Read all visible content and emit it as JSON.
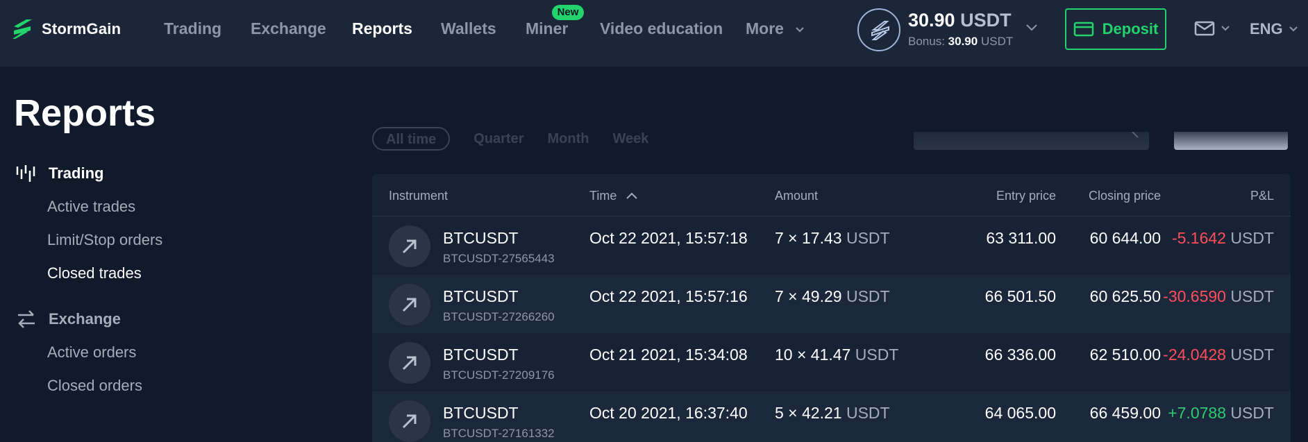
{
  "brand": {
    "name": "StormGain"
  },
  "nav": [
    {
      "label": "Trading"
    },
    {
      "label": "Exchange"
    },
    {
      "label": "Reports"
    },
    {
      "label": "Wallets"
    },
    {
      "label": "Miner",
      "badge": "New"
    },
    {
      "label": "Video education"
    },
    {
      "label": "More"
    }
  ],
  "balance": {
    "amount": "30.90",
    "currency": "USDT",
    "bonus_label": "Bonus:",
    "bonus_value": "30.90",
    "bonus_currency": "USDT"
  },
  "deposit": {
    "label": "Deposit"
  },
  "language": {
    "label": "ENG"
  },
  "page": {
    "title": "Reports"
  },
  "sidebar": {
    "sections": [
      {
        "label": "Trading",
        "items": [
          "Active trades",
          "Limit/Stop orders",
          "Closed trades"
        ]
      },
      {
        "label": "Exchange",
        "items": [
          "Active orders",
          "Closed orders"
        ]
      }
    ]
  },
  "filters": {
    "periods": [
      "All time",
      "Quarter",
      "Month",
      "Week"
    ]
  },
  "table": {
    "columns": [
      "Instrument",
      "Time",
      "Amount",
      "Entry price",
      "Closing price",
      "P&L"
    ],
    "rows": [
      {
        "instrument": "BTCUSDT",
        "id": "BTCUSDT-27565443",
        "time": "Oct 22 2021, 15:57:18",
        "amount": "7 × 17.43",
        "amount_unit": "USDT",
        "entry": "63 311.00",
        "closing": "60 644.00",
        "pnl": "-5.1642",
        "pnl_unit": "USDT"
      },
      {
        "instrument": "BTCUSDT",
        "id": "BTCUSDT-27266260",
        "time": "Oct 22 2021, 15:57:16",
        "amount": "7 × 49.29",
        "amount_unit": "USDT",
        "entry": "66 501.50",
        "closing": "60 625.50",
        "pnl": "-30.6590",
        "pnl_unit": "USDT"
      },
      {
        "instrument": "BTCUSDT",
        "id": "BTCUSDT-27209176",
        "time": "Oct 21 2021, 15:34:08",
        "amount": "10 × 41.47",
        "amount_unit": "USDT",
        "entry": "66 336.00",
        "closing": "62 510.00",
        "pnl": "-24.0428",
        "pnl_unit": "USDT"
      },
      {
        "instrument": "BTCUSDT",
        "id": "BTCUSDT-27161332",
        "time": "Oct 20 2021, 16:37:40",
        "amount": "5 × 42.21",
        "amount_unit": "USDT",
        "entry": "64 065.00",
        "closing": "66 459.00",
        "pnl": "+7.0788",
        "pnl_unit": "USDT"
      }
    ]
  },
  "colors": {
    "accent_green": "#23d36b",
    "loss_red": "#ff4d5a",
    "profit_green": "#2ecc71"
  }
}
